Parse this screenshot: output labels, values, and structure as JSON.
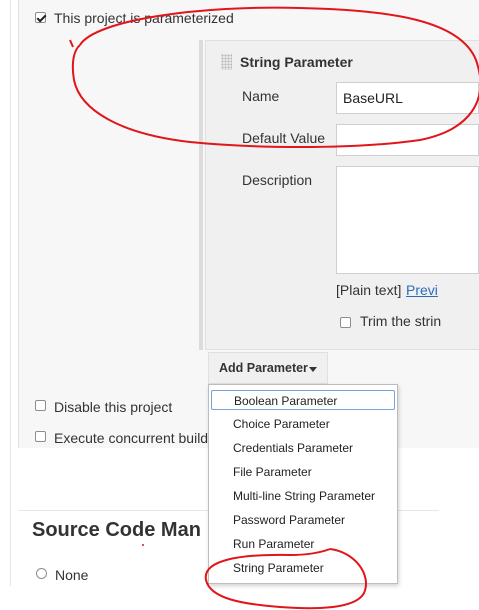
{
  "options": {
    "parameterized_label": "This project is parameterized",
    "disable_label": "Disable this project",
    "concurrent_label": "Execute concurrent build"
  },
  "param": {
    "title": "String Parameter",
    "name_label": "Name",
    "name_value": "BaseURL",
    "default_label": "Default Value",
    "default_value": "",
    "description_label": "Description",
    "plain_text": "[Plain text]",
    "preview_link": "Previ",
    "trim_label": "Trim the strin"
  },
  "add_parameter": {
    "label": "Add Parameter",
    "items": [
      "Boolean Parameter",
      "Choice Parameter",
      "Credentials Parameter",
      "File Parameter",
      "Multi-line String Parameter",
      "Password Parameter",
      "Run Parameter",
      "String Parameter"
    ]
  },
  "scm": {
    "heading": "Source Code Man",
    "none_label": "None"
  },
  "colors": {
    "annotation_red": "#e0161b",
    "link_blue": "#2a6ebb",
    "focus_blue": "#74a4d8"
  },
  "icons": [
    "checkbox-checked",
    "drag-handle",
    "caret-down-icon",
    "radio-empty"
  ]
}
